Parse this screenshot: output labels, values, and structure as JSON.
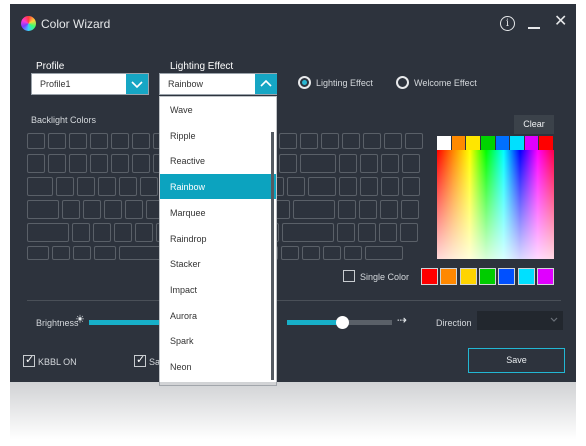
{
  "app": {
    "title": "Color Wizard",
    "icon": "color-wheel-icon"
  },
  "titlebar": {
    "info_icon": "info-icon",
    "minimize_icon": "minimize-icon",
    "close_icon": "close-icon"
  },
  "profile": {
    "label": "Profile",
    "value": "Profile1"
  },
  "lighting_effect": {
    "label": "Lighting Effect",
    "value": "Rainbow",
    "options": [
      "Wave",
      "Ripple",
      "Reactive",
      "Rainbow",
      "Marquee",
      "Raindrop",
      "Stacker",
      "Impact",
      "Aurora",
      "Spark",
      "Neon"
    ],
    "selected_index": 3
  },
  "mode": {
    "lighting_label": "Lighting Effect",
    "welcome_label": "Welcome Effect",
    "selected": "lighting"
  },
  "backlight": {
    "label": "Backlight Colors",
    "clear_label": "Clear"
  },
  "palette": {
    "top_swatches": [
      "#ffffff",
      "#ff8a00",
      "#ffe600",
      "#00d400",
      "#0070ff",
      "#00e0ff",
      "#e000ff",
      "#ff0000"
    ],
    "single_color_label": "Single Color",
    "preset_swatches": [
      "#ff0000",
      "#ff8800",
      "#ffd400",
      "#00cc00",
      "#0050ff",
      "#00e0ff",
      "#e000ff"
    ]
  },
  "brightness": {
    "label": "Brightness",
    "level": 0.9
  },
  "speed": {
    "level": 0.55
  },
  "direction": {
    "label": "Direction",
    "value": ""
  },
  "footer": {
    "kbbl_label": "KBBL ON",
    "save_check_label": "Sav",
    "save_button": "Save"
  }
}
